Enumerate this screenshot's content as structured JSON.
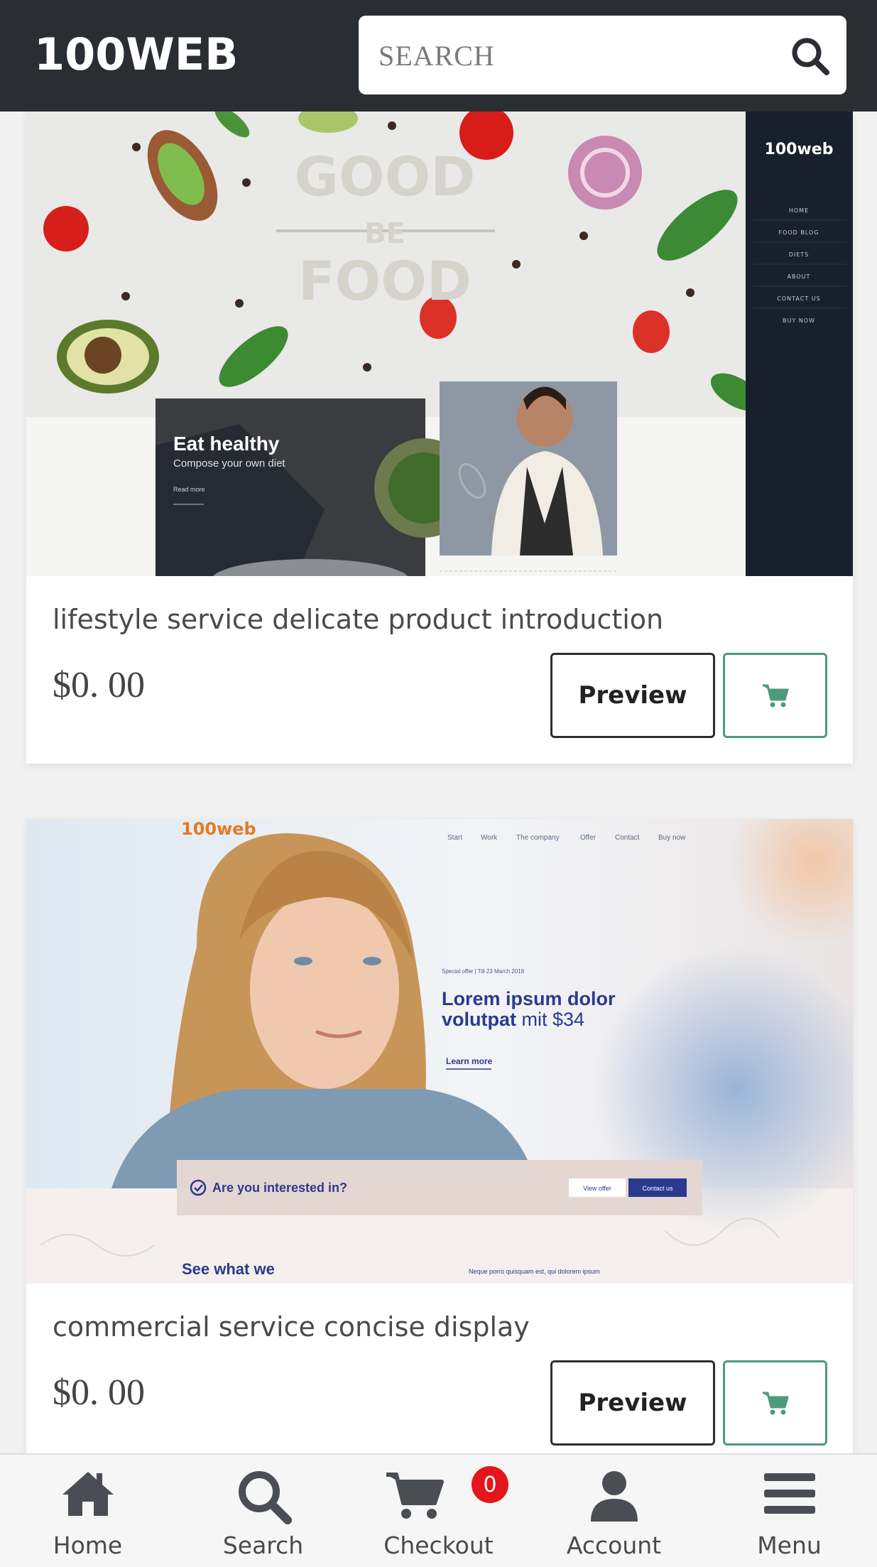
{
  "header": {
    "logo": "100WEB",
    "search_placeholder": "SEARCH"
  },
  "products": [
    {
      "title": "lifestyle service delicate product introduction",
      "price": "$0. 00",
      "preview_label": "Preview",
      "thumbnail": {
        "brand": "100web",
        "headline_top": "GOOD",
        "headline_mid": "BE",
        "headline_bottom": "FOOD",
        "nav": [
          "HOME",
          "FOOD BLOG",
          "DIETS",
          "ABOUT",
          "CONTACT US",
          "BUY NOW"
        ],
        "promo_title": "Eat healthy",
        "promo_sub": "Compose your own diet",
        "promo_link": "Read more"
      }
    },
    {
      "title": "commercial service concise display",
      "price": "$0. 00",
      "preview_label": "Preview",
      "thumbnail": {
        "brand": "100web",
        "nav": [
          "Start",
          "Work",
          "The company",
          "Offer",
          "Contact",
          "Buy now"
        ],
        "offer": "Special offer | Till 23 March 2018",
        "headline_line1": "Lorem ipsum dolor",
        "headline_line2_bold": "volutpat",
        "headline_line2_rest": " mit $34",
        "learn_more": "Learn more",
        "cta_question": "Are you interested in?",
        "cta_view": "View offer",
        "cta_contact": "Contact us",
        "bottom_heading": "See what we",
        "quote": "Neque porro quisquam est, qui dolorem ipsum"
      }
    }
  ],
  "bottom_nav": {
    "items": [
      {
        "label": "Home",
        "icon": "home-icon"
      },
      {
        "label": "Search",
        "icon": "search-icon"
      },
      {
        "label": "Checkout",
        "icon": "cart-icon"
      },
      {
        "label": "Account",
        "icon": "user-icon"
      },
      {
        "label": "Menu",
        "icon": "menu-icon"
      }
    ],
    "cart_count": "0"
  },
  "colors": {
    "header_bg": "#2a2e33",
    "cart_accent": "#4e9a7c",
    "badge": "#e4151b",
    "thumb2_blue": "#2b3a8f"
  }
}
